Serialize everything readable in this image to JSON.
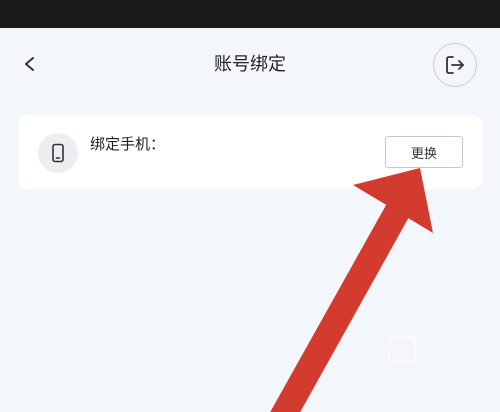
{
  "header": {
    "title": "账号绑定",
    "back_icon": "chevron-left-icon",
    "logout_icon": "logout-icon"
  },
  "card": {
    "label": "绑定手机：",
    "icon": "phone-icon",
    "change_button_label": "更换"
  },
  "annotation": {
    "arrow_color": "#d23b2d"
  },
  "colors": {
    "background": "#f3f6fb",
    "card": "#ffffff",
    "status_bar": "#1b1b1b"
  }
}
